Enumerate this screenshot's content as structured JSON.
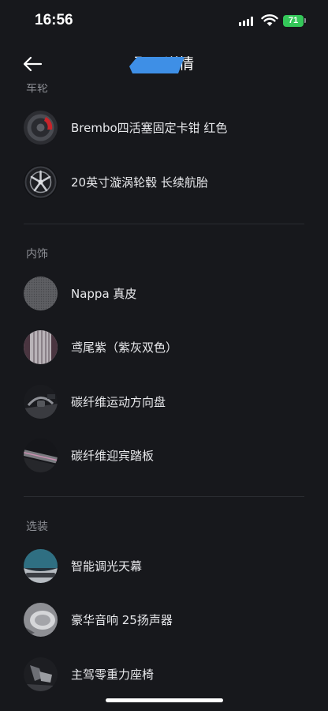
{
  "status_bar": {
    "time": "16:56",
    "battery_level": "71",
    "icons": [
      "cellular-signal-icon",
      "wifi-icon",
      "battery-icon"
    ]
  },
  "header": {
    "title": "配置详情",
    "back_icon": "arrow-left-icon",
    "partial_section_label": "车轮"
  },
  "colors": {
    "background": "#17181c",
    "text": "#e8e9ec",
    "secondary_text": "#8c8e94",
    "battery": "#34c759",
    "redaction": "#3e8fe6"
  },
  "sections": [
    {
      "items": [
        {
          "label": "Brembo四活塞固定卡钳 红色",
          "icon": "brake-caliper-image"
        },
        {
          "label": "20英寸漩涡轮毂 长续航胎",
          "icon": "wheel-rim-image"
        }
      ]
    },
    {
      "label": "内饰",
      "items": [
        {
          "label": "Nappa 真皮",
          "icon": "leather-texture-image"
        },
        {
          "label": "鸢尾紫（紫灰双色）",
          "icon": "seat-fabric-image"
        },
        {
          "label": "碳纤维运动方向盘",
          "icon": "steering-wheel-image"
        },
        {
          "label": "碳纤维迎宾踏板",
          "icon": "door-sill-image"
        }
      ]
    },
    {
      "label": "选装",
      "items": [
        {
          "label": "智能调光天幕",
          "icon": "sunroof-image"
        },
        {
          "label": "豪华音响 25扬声器",
          "icon": "speaker-image"
        },
        {
          "label": "主驾零重力座椅",
          "icon": "zero-gravity-seat-image"
        }
      ]
    }
  ]
}
